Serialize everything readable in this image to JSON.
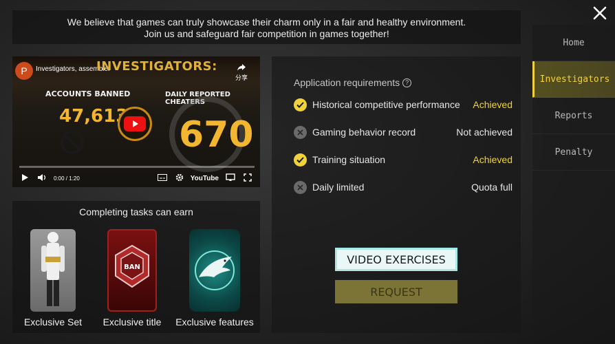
{
  "banner": {
    "line1": "We believe that games can truly showcase their charm only in a fair and healthy environment.",
    "line2": "Join us and safeguard fair competition in games together!"
  },
  "sidebar": {
    "items": [
      {
        "label": "Home",
        "active": false
      },
      {
        "label": "Investigators",
        "active": true
      },
      {
        "label": "Reports",
        "active": false
      },
      {
        "label": "Penalty",
        "active": false
      }
    ]
  },
  "video": {
    "channel_initial": "P",
    "title": "Investigators, assemble!",
    "heading": "INVESTIGATORS:",
    "share_label": "分享",
    "accounts_banned_label": "ACCOUNTS BANNED",
    "accounts_banned_value": "47,613",
    "daily_reported_label": "DAILY REPORTED CHEATERS",
    "daily_reported_value": "670",
    "time": "0:00 / 1:20",
    "youtube_label": "YouTube",
    "progress": 0
  },
  "rewards": {
    "title": "Completing tasks can earn",
    "items": [
      {
        "label": "Exclusive Set"
      },
      {
        "label": "Exclusive title"
      },
      {
        "label": "Exclusive features"
      }
    ],
    "title_badge_text": "BAN"
  },
  "requirements": {
    "title": "Application requirements",
    "rows": [
      {
        "label": "Historical competitive performance",
        "value": "Achieved",
        "met": true
      },
      {
        "label": "Gaming behavior record",
        "value": "Not achieved",
        "met": false
      },
      {
        "label": "Training situation",
        "value": "Achieved",
        "met": true
      },
      {
        "label": "Daily limited",
        "value": "Quota full",
        "met": false
      }
    ]
  },
  "buttons": {
    "video_exercises": "VIDEO EXERCISES",
    "request": "REQUEST"
  },
  "colors": {
    "accent": "#f2d23a",
    "video_button_bg": "#e9f8f6",
    "request_button_bg": "#7c7436"
  }
}
